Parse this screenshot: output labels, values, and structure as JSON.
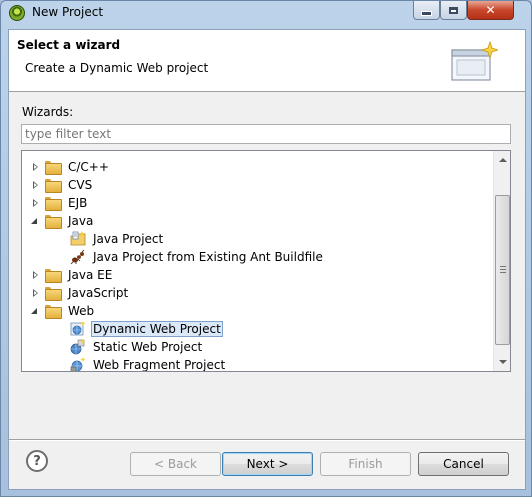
{
  "window": {
    "title": "New Project"
  },
  "banner": {
    "title": "Select a wizard",
    "description": "Create a Dynamic Web project"
  },
  "wizards": {
    "label": "Wizards:",
    "filter_placeholder": "type filter text",
    "filter_value": ""
  },
  "tree": {
    "items": [
      {
        "label": "C/C++",
        "type": "folder",
        "state": "collapsed",
        "level": 0
      },
      {
        "label": "CVS",
        "type": "folder",
        "state": "collapsed",
        "level": 0
      },
      {
        "label": "EJB",
        "type": "folder",
        "state": "collapsed",
        "level": 0
      },
      {
        "label": "Java",
        "type": "folder",
        "state": "expanded",
        "level": 0
      },
      {
        "label": "Java Project",
        "type": "java-project-icon",
        "level": 1
      },
      {
        "label": "Java Project from Existing Ant Buildfile",
        "type": "ant-icon",
        "level": 1
      },
      {
        "label": "Java EE",
        "type": "folder",
        "state": "collapsed",
        "level": 0
      },
      {
        "label": "JavaScript",
        "type": "folder",
        "state": "collapsed",
        "level": 0
      },
      {
        "label": "Web",
        "type": "folder",
        "state": "expanded",
        "level": 0
      },
      {
        "label": "Dynamic Web Project",
        "type": "web-project-icon",
        "level": 1,
        "selected": true
      },
      {
        "label": "Static Web Project",
        "type": "static-web-icon",
        "level": 1
      },
      {
        "label": "Web Fragment Project",
        "type": "web-fragment-icon",
        "level": 1
      }
    ]
  },
  "buttons": {
    "help": "?",
    "back": "< Back",
    "next": "Next >",
    "finish": "Finish",
    "cancel": "Cancel"
  },
  "colors": {
    "selection_bg": "#dbe8f7",
    "selection_border": "#7da2ce",
    "close_button": "#c8472c"
  }
}
